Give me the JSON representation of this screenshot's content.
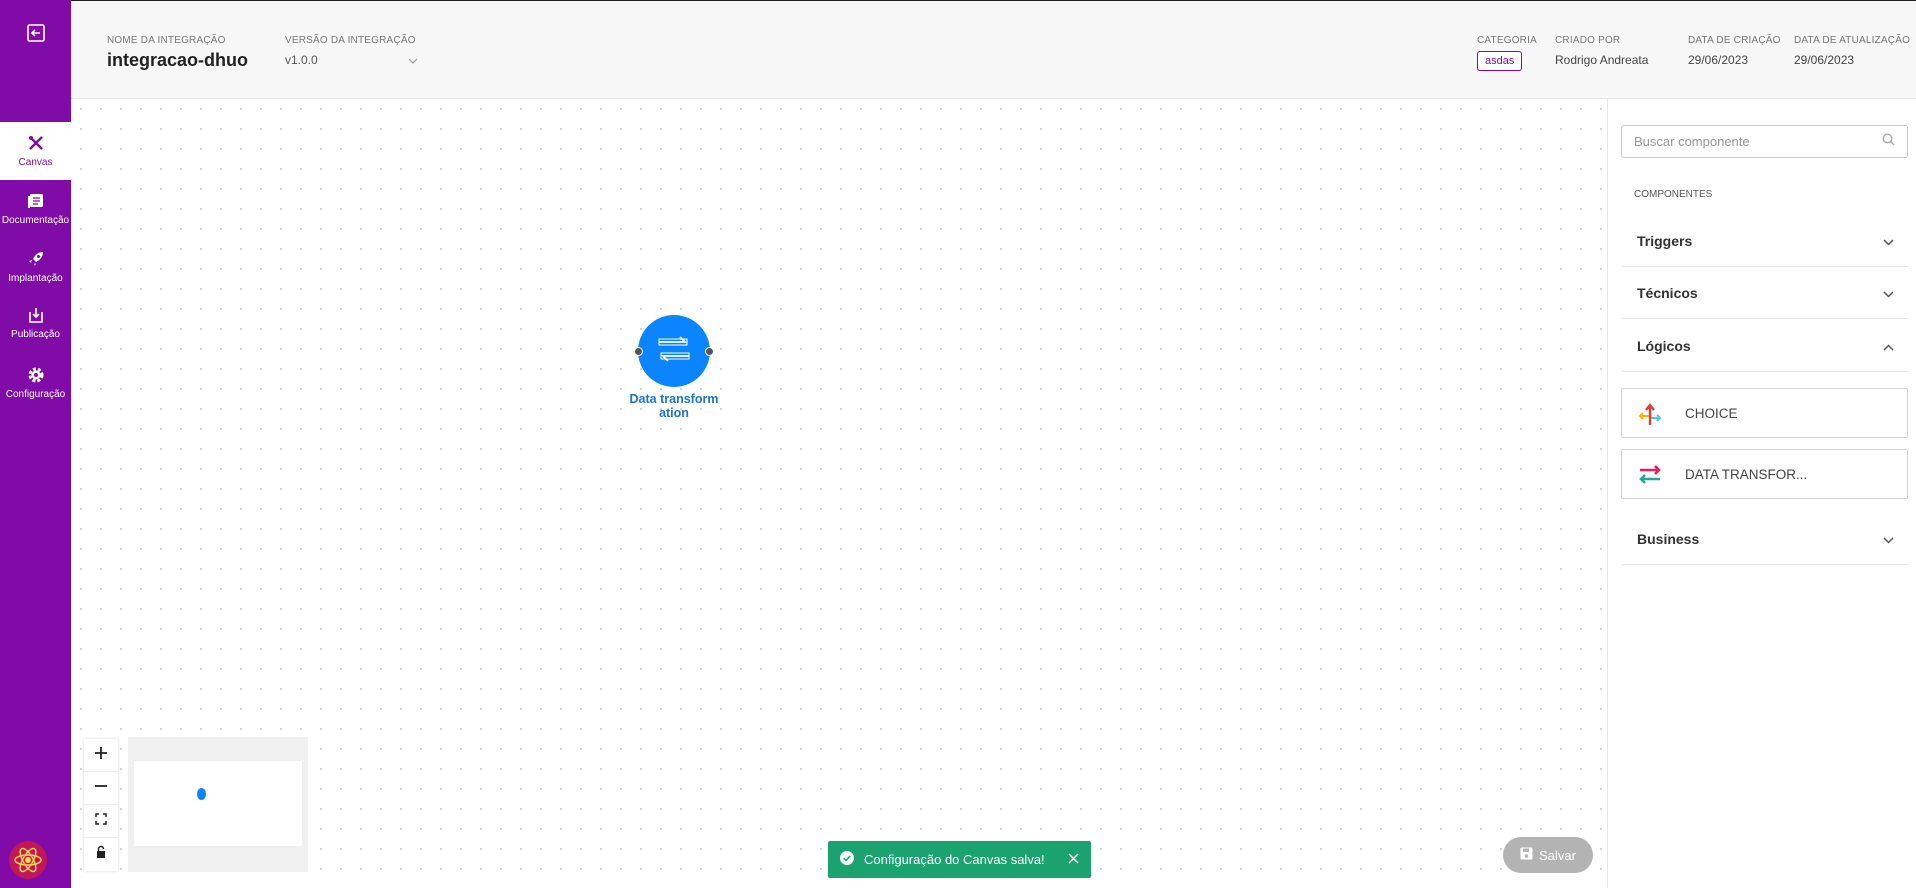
{
  "header": {
    "integration_name_label": "NOME DA INTEGRAÇÃO",
    "integration_name": "integracao-dhuo",
    "version_label": "VERSÃO DA INTEGRAÇÃO",
    "version": "v1.0.0",
    "category_label": "CATEGORIA",
    "category": "asdas",
    "created_by_label": "CRIADO POR",
    "created_by": "Rodrigo Andreata",
    "created_date_label": "DATA DE CRIAÇÃO",
    "created_date": "29/06/2023",
    "updated_date_label": "DATA DE ATUALIZAÇÃO",
    "updated_date": "29/06/2023"
  },
  "sidebar": {
    "items": [
      {
        "label": "Canvas",
        "icon": "canvas-tools-icon",
        "active": true
      },
      {
        "label": "Documentação",
        "icon": "documentation-icon"
      },
      {
        "label": "Implantação",
        "icon": "rocket-icon"
      },
      {
        "label": "Publicação",
        "icon": "publish-icon"
      },
      {
        "label": "Configuração",
        "icon": "gear-icon"
      }
    ]
  },
  "canvas": {
    "node_label": "Data transformation",
    "toast_message": "Configuração do Canvas salva!",
    "save_label": "Salvar"
  },
  "panel": {
    "search_placeholder": "Buscar componente",
    "section_title": "COMPONENTES",
    "groups": {
      "triggers": "Triggers",
      "tecnicos": "Técnicos",
      "logicos": "Lógicos",
      "business": "Business"
    },
    "components": {
      "choice": "CHOICE",
      "data_transform": "DATA TRANSFOR..."
    }
  },
  "colors": {
    "brand": "#800ba6",
    "node": "#0a84ff",
    "toast": "#1aa36f"
  }
}
